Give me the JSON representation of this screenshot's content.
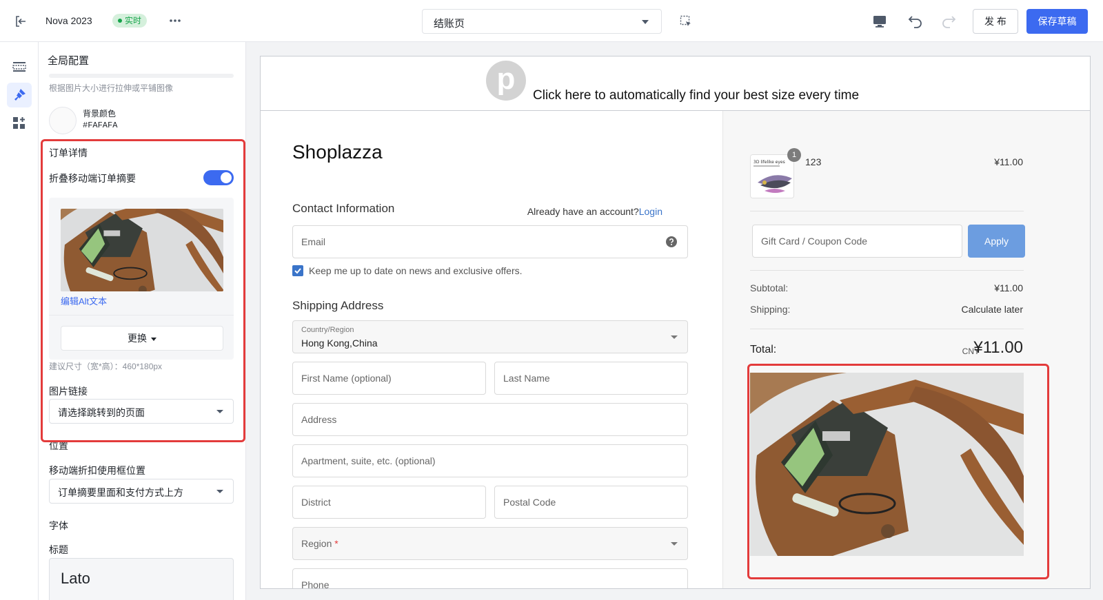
{
  "topbar": {
    "theme_name": "Nova 2023",
    "live_badge": "实时",
    "page_select": "结账页",
    "publish_label": "发 布",
    "save_label": "保存草稿"
  },
  "panel": {
    "title": "全局配置",
    "stretch_hint": "根据图片大小进行拉伸或平铺图像",
    "bg_color_label": "背景颜色",
    "bg_color_value": "#FAFAFA",
    "order_details_title": "订单详情",
    "collapse_mobile_label": "折叠移动端订单摘要",
    "collapse_mobile_on": true,
    "edit_alt_label": "编辑Alt文本",
    "replace_label": "更换",
    "size_hint": "建议尺寸（宽*高）：460*180px",
    "image_link_label": "图片链接",
    "image_link_placeholder": "请选择跳转到的页面",
    "position_title": "位置",
    "mobile_position_label": "移动端折扣使用框位置",
    "mobile_position_value": "订单摘要里面和支付方式上方",
    "font_title": "字体",
    "heading_label": "标题",
    "heading_font": "Lato"
  },
  "preview": {
    "banner_logo_letter": "p",
    "banner_text": "Click here to automatically find your best size every time",
    "shop_name": "Shoplazza",
    "contact_title": "Contact Information",
    "have_account": "Already have an account?",
    "login_link": "Login",
    "email_placeholder": "Email",
    "newsletter_label": "Keep me up to date on news and exclusive offers.",
    "newsletter_checked": true,
    "shipping_title": "Shipping Address",
    "country_label": "Country/Region",
    "country_value": "Hong Kong,China",
    "first_name_placeholder": "First Name (optional)",
    "last_name_placeholder": "Last Name",
    "address_placeholder": "Address",
    "apartment_placeholder": "Apartment, suite, etc. (optional)",
    "district_placeholder": "District",
    "postal_placeholder": "Postal Code",
    "region_placeholder": "Region",
    "region_required_mark": "*",
    "phone_placeholder": "Phone"
  },
  "summary": {
    "product_name": "123",
    "product_qty": "1",
    "product_price": "¥11.00",
    "product_thumb_caption": "3D lifelike eyes",
    "coupon_placeholder": "Gift Card / Coupon Code",
    "apply_label": "Apply",
    "subtotal_label": "Subtotal:",
    "subtotal_value": "¥11.00",
    "shipping_label": "Shipping:",
    "shipping_value": "Calculate later",
    "total_label": "Total:",
    "total_currency": "CNY",
    "total_value": "¥11.00"
  },
  "colors": {
    "accent": "#3c6af0",
    "live_green": "#16a34a",
    "highlight_red": "#e33b3b",
    "apply_button": "#6c9de0",
    "link_blue": "#3a74c9"
  }
}
